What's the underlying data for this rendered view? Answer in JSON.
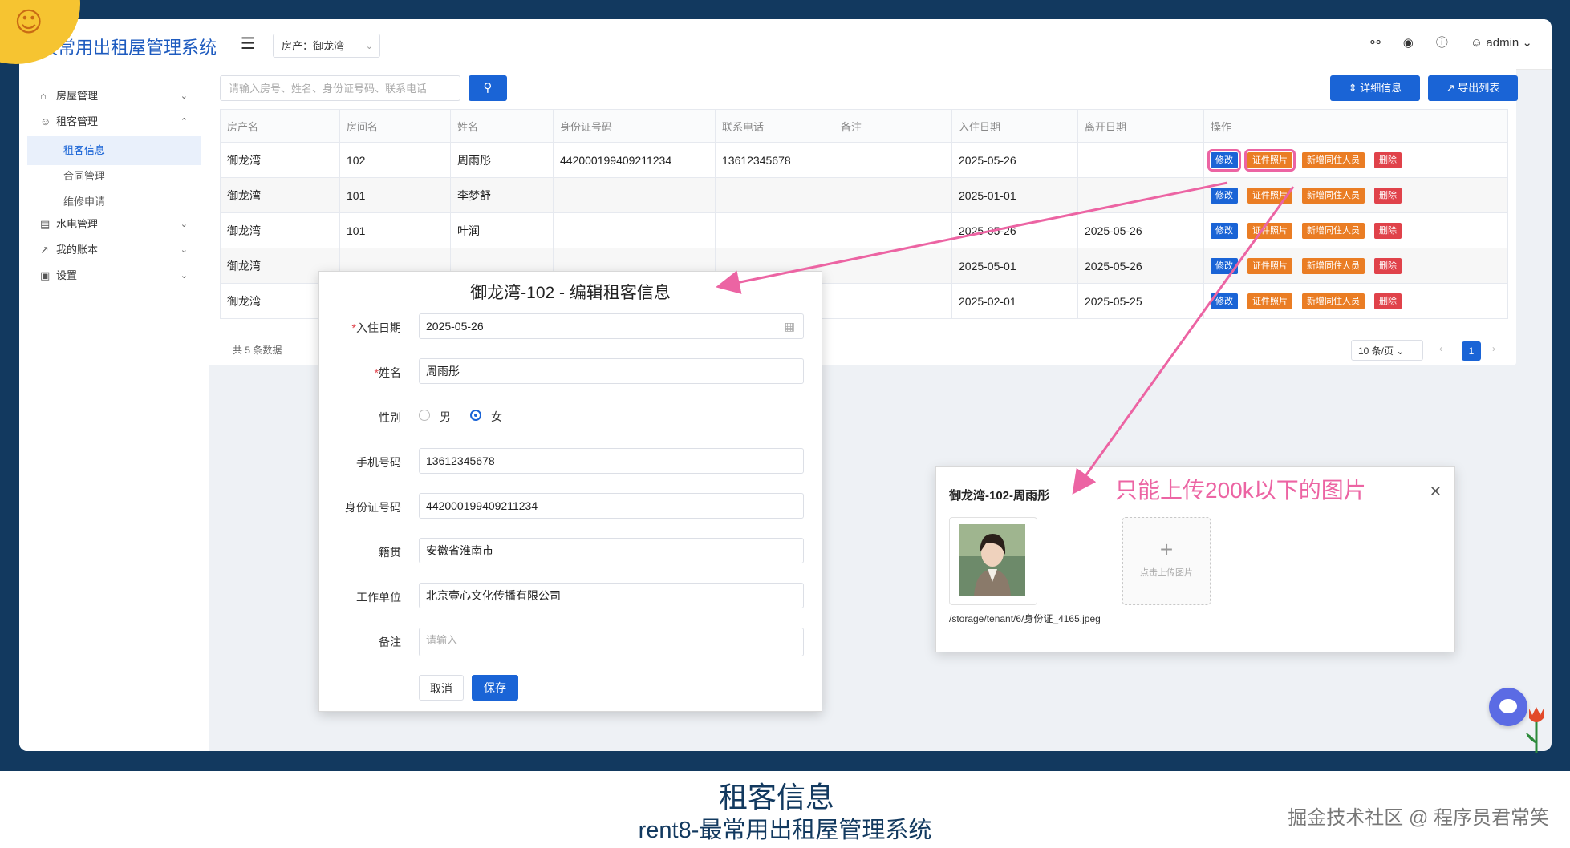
{
  "app": {
    "title": "最常用出租屋管理系统",
    "property_label": "房产：",
    "property_value": "御龙湾",
    "user": "admin"
  },
  "sidebar": {
    "items": [
      {
        "label": "房屋管理",
        "icon": "home-icon"
      },
      {
        "label": "租客管理",
        "icon": "user-icon"
      },
      {
        "label": "水电管理",
        "icon": "meter-icon"
      },
      {
        "label": "我的账本",
        "icon": "chart-icon"
      },
      {
        "label": "设置",
        "icon": "settings-icon"
      }
    ],
    "sub_items": [
      "租客信息",
      "合同管理",
      "维修申请"
    ]
  },
  "toolbar": {
    "search_placeholder": "请输入房号、姓名、身份证号码、联系电话",
    "detail_label": "详细信息",
    "export_label": "导出列表"
  },
  "table": {
    "columns": [
      "房产名",
      "房间名",
      "姓名",
      "身份证号码",
      "联系电话",
      "备注",
      "入住日期",
      "离开日期",
      "操作"
    ],
    "rows": [
      [
        "御龙湾",
        "102",
        "周雨彤",
        "442000199409211234",
        "13612345678",
        "",
        "2025-05-26",
        ""
      ],
      [
        "御龙湾",
        "101",
        "李梦舒",
        "",
        "",
        "",
        "2025-01-01",
        ""
      ],
      [
        "御龙湾",
        "101",
        "叶润",
        "",
        "",
        "",
        "2025-05-26",
        "2025-05-26"
      ],
      [
        "御龙湾",
        "",
        "",
        "",
        "",
        "",
        "2025-05-01",
        "2025-05-26"
      ],
      [
        "御龙湾",
        "",
        "",
        "",
        "",
        "",
        "2025-02-01",
        "2025-05-25"
      ]
    ],
    "actions": {
      "edit": "修改",
      "photo": "证件照片",
      "add": "新增同住人员",
      "delete": "删除"
    },
    "total": "共 5 条数据",
    "page_size": "10 条/页",
    "page": "1"
  },
  "edit_dialog": {
    "title": "御龙湾-102 - 编辑租客信息",
    "fields": {
      "checkin": {
        "label": "入住日期",
        "value": "2025-05-26"
      },
      "name": {
        "label": "姓名",
        "value": "周雨彤"
      },
      "gender": {
        "label": "性别",
        "male": "男",
        "female": "女",
        "selected": "女"
      },
      "phone": {
        "label": "手机号码",
        "value": "13612345678"
      },
      "idcard": {
        "label": "身份证号码",
        "value": "442000199409211234"
      },
      "native": {
        "label": "籍贯",
        "value": "安徽省淮南市"
      },
      "work": {
        "label": "工作单位",
        "value": "北京壹心文化传播有限公司"
      },
      "remark": {
        "label": "备注",
        "placeholder": "请输入"
      }
    },
    "cancel": "取消",
    "save": "保存"
  },
  "photo_dialog": {
    "title": "御龙湾-102-周雨彤",
    "upload_text": "点击上传图片",
    "path": "/storage/tenant/6/身份证_4165.jpeg"
  },
  "annotation": "只能上传200k以下的图片",
  "caption": {
    "title": "租客信息",
    "subtitle": "rent8-最常用出租屋管理系统",
    "watermark": "掘金技术社区 @ 程序员君常笑"
  },
  "colors": {
    "primary": "#1a64d6",
    "orange": "#ea7d24",
    "red": "#e0424a",
    "frame": "#12395f",
    "highlight": "#ec64a3"
  }
}
